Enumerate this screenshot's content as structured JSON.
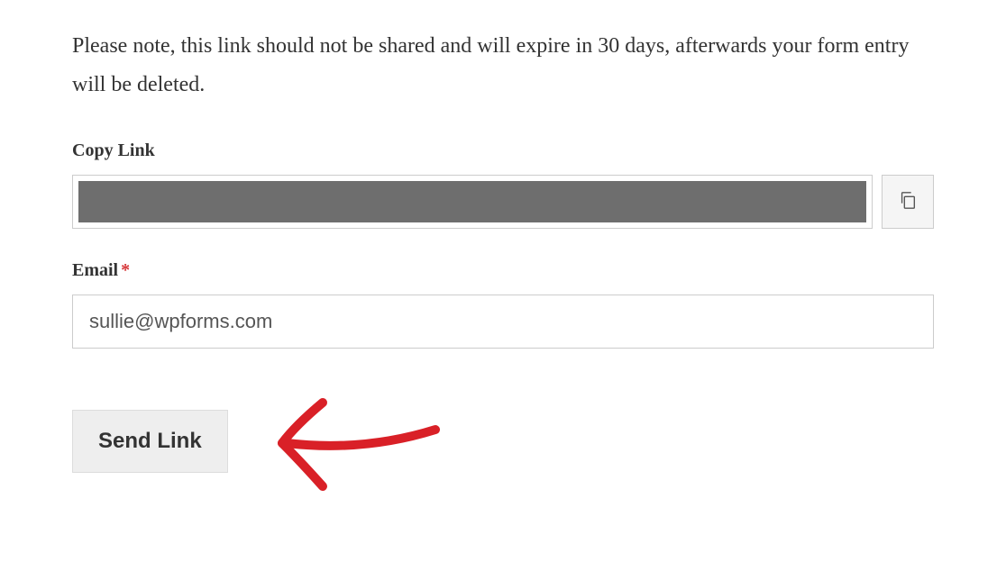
{
  "notice": "Please note, this link should not be shared and will expire in 30 days, afterwards your form entry will be deleted.",
  "copyLink": {
    "label": "Copy Link",
    "iconName": "copy-icon"
  },
  "email": {
    "label": "Email",
    "required": "*",
    "value": "sullie@wpforms.com"
  },
  "submit": {
    "label": "Send Link"
  },
  "annotation": {
    "color": "#d92027"
  }
}
